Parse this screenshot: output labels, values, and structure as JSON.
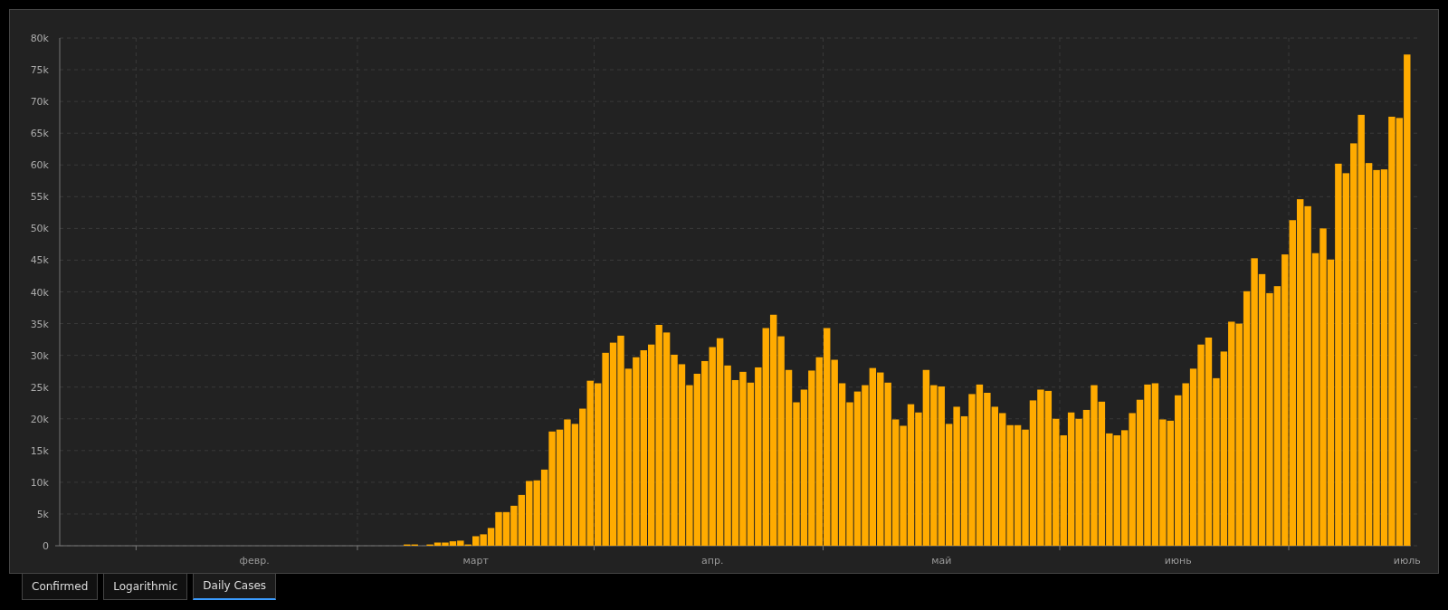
{
  "chart": {
    "chart_data": {
      "type": "bar",
      "grid": true,
      "categories": [
        null,
        null,
        null,
        null,
        null,
        null,
        null,
        null,
        null,
        null,
        null,
        null,
        null,
        null,
        null,
        null,
        null,
        null,
        null,
        null,
        null,
        null,
        null,
        null,
        null,
        "февр.",
        null,
        null,
        null,
        null,
        null,
        null,
        null,
        null,
        null,
        null,
        null,
        null,
        null,
        null,
        null,
        null,
        null,
        null,
        null,
        null,
        null,
        null,
        null,
        null,
        null,
        null,
        null,
        null,
        "март",
        null,
        null,
        null,
        null,
        null,
        null,
        null,
        null,
        null,
        null,
        null,
        null,
        null,
        null,
        null,
        null,
        null,
        null,
        null,
        null,
        null,
        null,
        null,
        null,
        null,
        null,
        null,
        null,
        null,
        null,
        "апр.",
        null,
        null,
        null,
        null,
        null,
        null,
        null,
        null,
        null,
        null,
        null,
        null,
        null,
        null,
        null,
        null,
        null,
        null,
        null,
        null,
        null,
        null,
        null,
        null,
        null,
        null,
        null,
        null,
        null,
        "май",
        null,
        null,
        null,
        null,
        null,
        null,
        null,
        null,
        null,
        null,
        null,
        null,
        null,
        null,
        null,
        null,
        null,
        null,
        null,
        null,
        null,
        null,
        null,
        null,
        null,
        null,
        null,
        null,
        null,
        null,
        "июнь",
        null,
        null,
        null,
        null,
        null,
        null,
        null,
        null,
        null,
        null,
        null,
        null,
        null,
        null,
        null,
        null,
        null,
        null,
        null,
        null,
        null,
        null,
        null,
        null,
        null,
        null,
        null,
        null,
        null,
        "июль"
      ],
      "values": [
        0,
        0,
        0,
        0,
        0,
        0,
        0,
        0,
        0,
        0,
        0,
        0,
        0,
        0,
        0,
        0,
        0,
        0,
        0,
        0,
        0,
        0,
        0,
        0,
        0,
        0,
        0,
        0,
        0,
        0,
        0,
        0,
        0,
        0,
        0,
        0,
        0,
        0,
        0,
        0,
        0,
        0,
        0,
        0,
        0,
        200,
        200,
        0,
        200,
        500,
        500,
        700,
        800,
        200,
        1500,
        1800,
        2800,
        5300,
        5300,
        6300,
        8000,
        10200,
        10300,
        12000,
        18000,
        18300,
        19900,
        19200,
        21600,
        26000,
        25600,
        30400,
        32000,
        33100,
        27900,
        29700,
        30800,
        31700,
        34800,
        33600,
        30100,
        28600,
        25300,
        27100,
        29100,
        31300,
        32700,
        28400,
        26100,
        27400,
        25700,
        28100,
        34300,
        36400,
        33000,
        27700,
        22600,
        24600,
        27600,
        29700,
        34300,
        29300,
        25600,
        22600,
        24300,
        25300,
        28000,
        27300,
        25700,
        19900,
        18900,
        22300,
        21000,
        27700,
        25300,
        25100,
        19200,
        21900,
        20400,
        23900,
        25400,
        24100,
        21900,
        20900,
        19000,
        19000,
        18300,
        22900,
        24600,
        24400,
        20000,
        17400,
        21000,
        20000,
        21400,
        25300,
        22700,
        17700,
        17400,
        18200,
        20900,
        23000,
        25400,
        25600,
        19900,
        19700,
        23700,
        25600,
        27900,
        31700,
        32800,
        26400,
        30600,
        35300,
        35000,
        40100,
        45300,
        42800,
        39800,
        40900,
        45900,
        51300,
        54600,
        53500,
        46100,
        50000,
        45100,
        60200,
        58700,
        63400,
        67900,
        60300,
        59200,
        59300,
        67600,
        67400,
        77400
      ],
      "ylim": [
        0,
        80000
      ],
      "yticks": [
        {
          "value": 0,
          "label": "0"
        },
        {
          "value": 5000,
          "label": "5k"
        },
        {
          "value": 10000,
          "label": "10k"
        },
        {
          "value": 15000,
          "label": "15k"
        },
        {
          "value": 20000,
          "label": "20k"
        },
        {
          "value": 25000,
          "label": "25k"
        },
        {
          "value": 30000,
          "label": "30k"
        },
        {
          "value": 35000,
          "label": "35k"
        },
        {
          "value": 40000,
          "label": "40k"
        },
        {
          "value": 45000,
          "label": "45k"
        },
        {
          "value": 50000,
          "label": "50k"
        },
        {
          "value": 55000,
          "label": "55k"
        },
        {
          "value": 60000,
          "label": "60k"
        },
        {
          "value": 65000,
          "label": "65k"
        },
        {
          "value": 70000,
          "label": "70k"
        },
        {
          "value": 75000,
          "label": "75k"
        },
        {
          "value": 80000,
          "label": "80k"
        }
      ]
    }
  },
  "tabs": [
    {
      "label": "Confirmed",
      "selected": false
    },
    {
      "label": "Logarithmic",
      "selected": false
    },
    {
      "label": "Daily Cases",
      "selected": true
    }
  ]
}
